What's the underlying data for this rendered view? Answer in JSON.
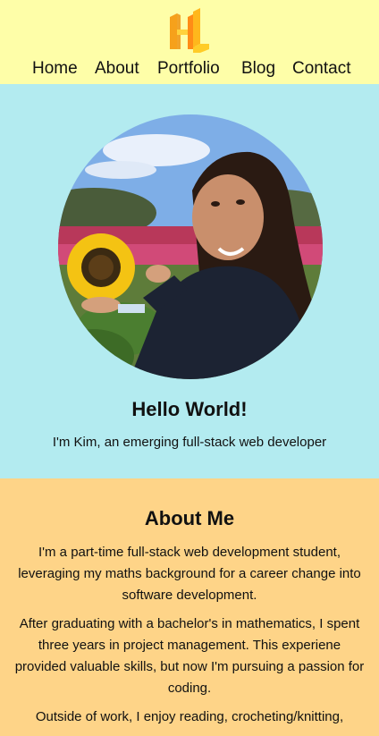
{
  "nav": {
    "items": [
      "Home",
      "About",
      "Portfolio",
      "Blog",
      "Contact"
    ]
  },
  "hero": {
    "title": "Hello World!",
    "subtitle": "I'm Kim, an emerging full-stack web developer"
  },
  "about": {
    "title": "About Me",
    "paragraphs": [
      "I'm a part-time full-stack web development student, leveraging my maths background for a career change into software development.",
      "After graduating with a bachelor's in mathematics, I spent three years in project management. This experiene provided valuable skills, but now I'm pursuing a passion for coding.",
      "Outside of work, I enjoy reading, crocheting/knitting,"
    ]
  },
  "colors": {
    "header_bg": "#fefea8",
    "hero_bg": "#b3ebf0",
    "about_bg": "#fed488",
    "logo": "#f6b11b"
  },
  "icons": {
    "logo": "hl-monogram-logo"
  }
}
